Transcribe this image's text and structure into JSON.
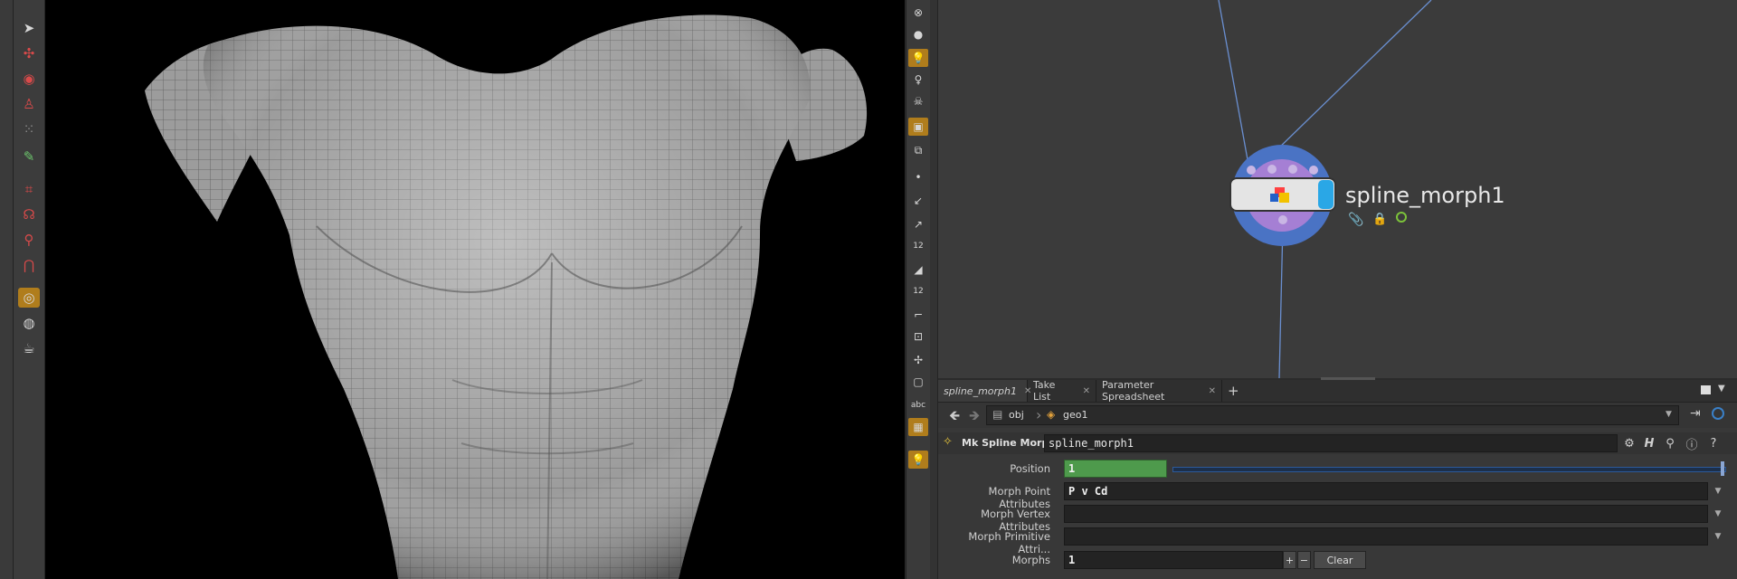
{
  "network": {
    "node_name": "spline_morph1",
    "icons": [
      "paperclip-icon",
      "lock-icon",
      "bypass-ok-icon"
    ]
  },
  "tabs": [
    {
      "label": "spline_morph1",
      "current": true
    },
    {
      "label": "Take List",
      "current": false
    },
    {
      "label": "Parameter Spreadsheet",
      "current": false
    }
  ],
  "path": {
    "root": "obj",
    "child": "geo1"
  },
  "params": {
    "node_type": "Mk Spline Morph",
    "node_name": "spline_morph1",
    "rows": {
      "position": {
        "label": "Position",
        "value": "1",
        "slider_fraction": 1.0
      },
      "point_attrs": {
        "label": "Morph Point Attributes",
        "value": "P v Cd"
      },
      "vertex_attrs": {
        "label": "Morph Vertex Attributes",
        "value": ""
      },
      "primitive_attrs": {
        "label": "Morph Primitive Attri...",
        "value": ""
      },
      "morphs": {
        "label": "Morphs",
        "value": "1",
        "clear_label": "Clear"
      }
    }
  },
  "colors": {
    "accent": "#b07d1c",
    "position_fill": "#4e9a4c",
    "node_ring": "#4a73c4",
    "node_inner": "#a57fd4",
    "wire": "#6a8fd0"
  },
  "mid_toolbar_labels": {
    "n12a": "12",
    "n12b": "12",
    "abc": "abc"
  }
}
